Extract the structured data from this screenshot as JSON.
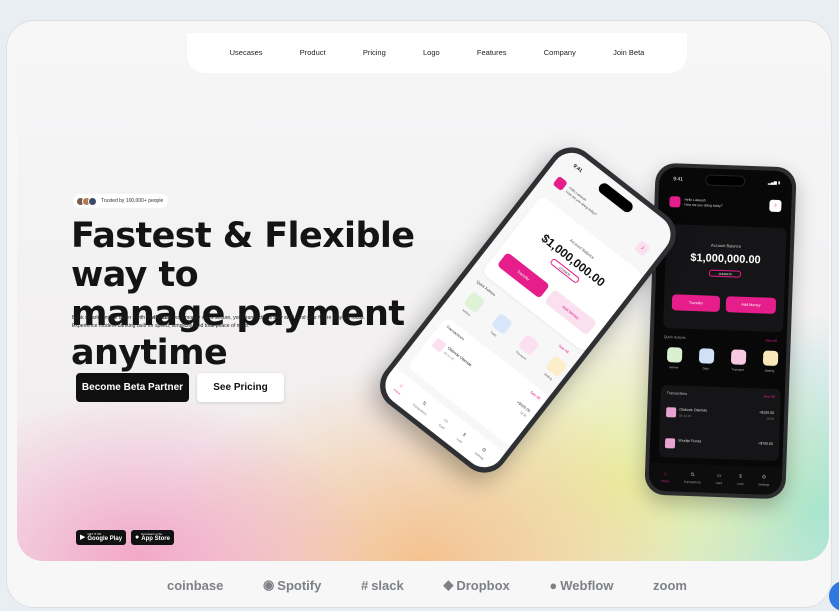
{
  "nav": {
    "items": [
      "Usecases",
      "Product",
      "Pricing",
      "Logo",
      "Features",
      "Company",
      "Join Beta"
    ]
  },
  "hero": {
    "trusted": "Trusted by 100,000+ people",
    "headline_line1": "Fastest & Flexible way to",
    "headline_line2": "manage payment anytime",
    "desc_before": "Bank smarter, move faster - with ",
    "desc_brand": "SwiftVault",
    "desc_after": ", your money stays secure, your transactions stay swift, and your future stays in focus. Experience modern banking built for speed, simplicity, and total peace of mind.",
    "primary_button": "Become Beta Partner",
    "secondary_button": "See Pricing"
  },
  "stores": {
    "google_small": "GET IT ON",
    "google": "Google Play",
    "apple_small": "Download on the",
    "apple": "App Store"
  },
  "phone": {
    "time": "9:41",
    "greeting": "Hello Lukeeah",
    "greeting_sub": "How are you doing today?",
    "balance_label": "Account Balance",
    "balance": "$1,000,000.00",
    "account": "12345678",
    "transfer": "Transfer",
    "add_money": "Add Money",
    "quick_actions": "Quick Actions",
    "see_all": "See All",
    "tiles": [
      "Airtime",
      "Data",
      "Transport",
      "Betting"
    ],
    "transactions": "Transactions",
    "tx1_name": "Olabode Olamide",
    "tx1_date": "05-12-25",
    "tx1_amount": "+$100.00",
    "tx1_time": "18:58",
    "tx2_name": "Shodipi Funda",
    "tx2_amount": "+$700.00",
    "tabs": [
      "Home",
      "Transactions",
      "Card",
      "Loan",
      "Settings"
    ]
  },
  "partners": [
    "coinbase",
    "Spotify",
    "slack",
    "Dropbox",
    "Webflow",
    "zoom"
  ],
  "colors": {
    "accent": "#e61e8c",
    "dark": "#0f0f10",
    "logo_gray": "#7d8086"
  }
}
